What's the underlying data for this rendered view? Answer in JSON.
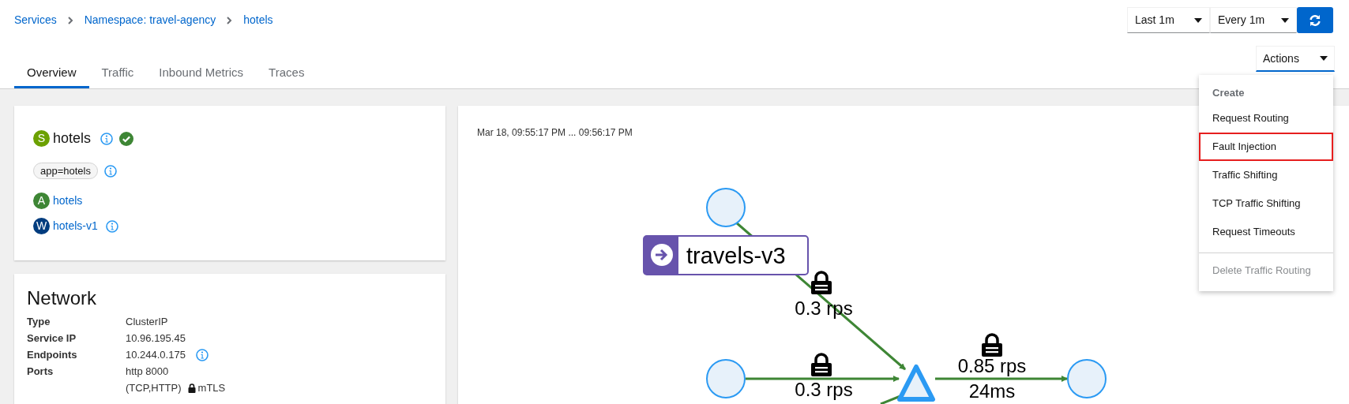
{
  "breadcrumbs": [
    "Services",
    "Namespace: travel-agency",
    "hotels"
  ],
  "toolbar": {
    "time_range": "Last 1m",
    "refresh_interval": "Every 1m"
  },
  "tabs": [
    {
      "label": "Overview",
      "selected": true
    },
    {
      "label": "Traffic",
      "selected": false
    },
    {
      "label": "Inbound Metrics",
      "selected": false
    },
    {
      "label": "Traces",
      "selected": false
    }
  ],
  "actions": {
    "label": "Actions",
    "expanded": true,
    "menu_heading": "Create",
    "items": [
      {
        "label": "Request Routing",
        "highlighted": false,
        "disabled": false
      },
      {
        "label": "Fault Injection",
        "highlighted": true,
        "disabled": false
      },
      {
        "label": "Traffic Shifting",
        "highlighted": false,
        "disabled": false
      },
      {
        "label": "TCP Traffic Shifting",
        "highlighted": false,
        "disabled": false
      },
      {
        "label": "Request Timeouts",
        "highlighted": false,
        "disabled": false
      },
      {
        "label": "Delete Traffic Routing",
        "highlighted": false,
        "disabled": true
      }
    ]
  },
  "service": {
    "badge": "S",
    "color": "#6ca100",
    "name": "hotels",
    "healthy": true,
    "label_chip": "app=hotels",
    "links": [
      {
        "badge": "A",
        "color": "#3e8635",
        "name": "hotels",
        "info": false
      },
      {
        "badge": "W",
        "color": "#003c7e",
        "name": "hotels-v1",
        "info": true
      }
    ]
  },
  "network": {
    "title": "Network",
    "rows": [
      {
        "label": "Type",
        "value": "ClusterIP",
        "info": false
      },
      {
        "label": "Service IP",
        "value": "10.96.195.45",
        "info": false
      },
      {
        "label": "Endpoints",
        "value": "10.244.0.175",
        "info": true
      },
      {
        "label": "Ports",
        "value": "http 8000",
        "info": false
      }
    ],
    "ports_protocol": "(TCP,HTTP)",
    "mtls": "mTLS"
  },
  "graph": {
    "timestamp": "Mar 18, 09:55:17 PM ... 09:56:17 PM",
    "node_label": "travels-v3",
    "edge_labels": [
      {
        "lines": [
          "0.3 rps"
        ]
      },
      {
        "lines": [
          "0.3 rps"
        ]
      },
      {
        "lines": [
          "0.85 rps",
          "24ms"
        ]
      }
    ]
  }
}
